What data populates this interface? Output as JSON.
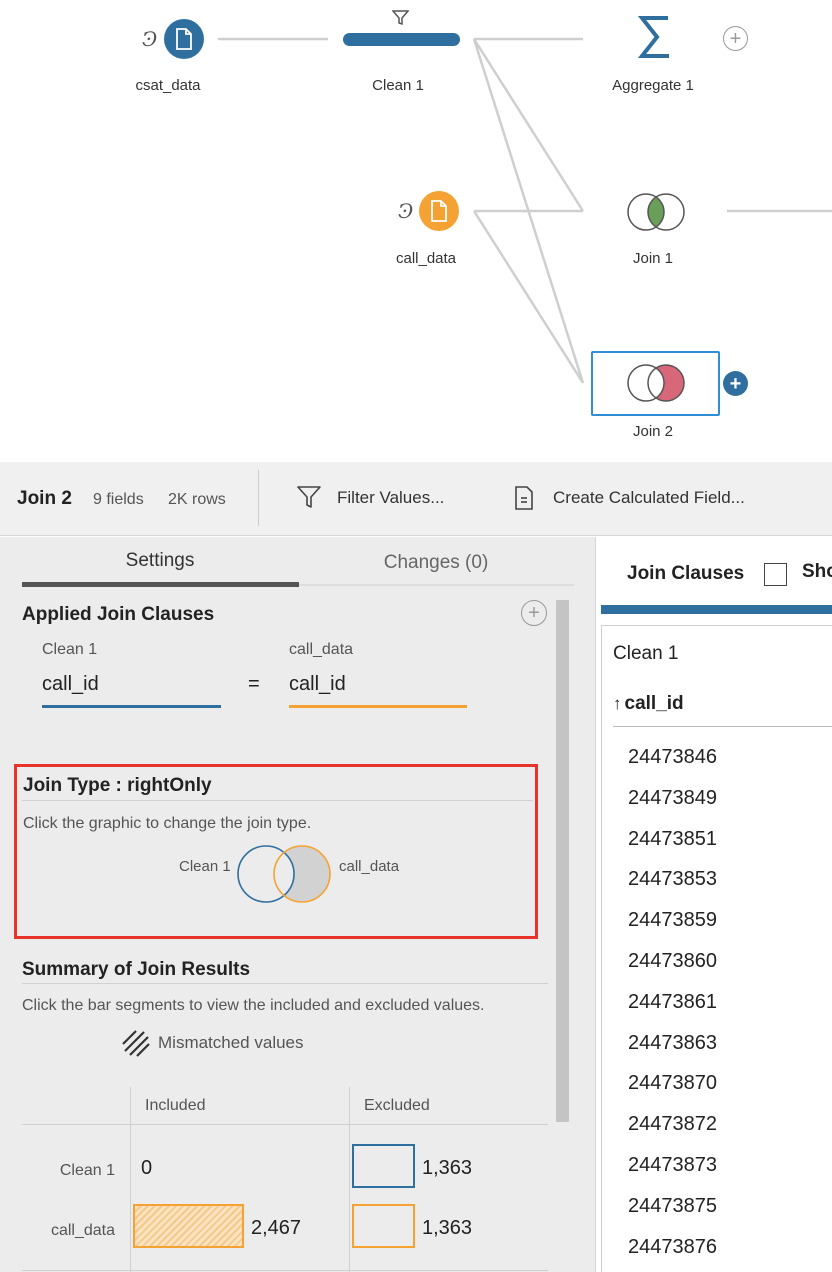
{
  "flow": {
    "nodes": {
      "csat": "csat_data",
      "clean": "Clean 1",
      "aggregate": "Aggregate 1",
      "call": "call_data",
      "join1": "Join 1",
      "join2": "Join 2"
    }
  },
  "toolbar": {
    "step_name": "Join 2",
    "fields": "9 fields",
    "rows": "2K rows",
    "filter_label": "Filter Values...",
    "calc_label": "Create Calculated Field..."
  },
  "settings": {
    "tabs": [
      "Settings",
      "Changes (0)"
    ],
    "applied_title": "Applied Join Clauses",
    "left_source": "Clean 1",
    "right_source": "call_data",
    "left_field": "call_id",
    "operator": "=",
    "right_field": "call_id",
    "join_type_title": "Join Type : rightOnly",
    "join_type_hint": "Click the graphic to change the join type.",
    "venn_left_label": "Clean 1",
    "venn_right_label": "call_data",
    "summary_title": "Summary of Join Results",
    "summary_hint": "Click the bar segments to view the included and excluded values.",
    "mismatched_label": "Mismatched values",
    "results": {
      "col_included": "Included",
      "col_excluded": "Excluded",
      "rows": [
        {
          "label": "Clean 1",
          "included": "0",
          "excluded": "1,363"
        },
        {
          "label": "call_data",
          "included": "2,467",
          "excluded": "1,363"
        }
      ]
    }
  },
  "clauses_panel": {
    "title": "Join Clauses",
    "show_checkbox_label": "Sho",
    "source": "Clean 1",
    "column": "call_id",
    "sort_glyph": "↑",
    "values": [
      "24473846",
      "24473849",
      "24473851",
      "24473853",
      "24473859",
      "24473860",
      "24473861",
      "24473863",
      "24473870",
      "24473872",
      "24473873",
      "24473875",
      "24473876"
    ]
  },
  "colors": {
    "blue": "#2f6fa0",
    "orange": "#f4a233",
    "selection": "#2f8ed4",
    "join_green": "#6a9f5a",
    "join_red": "#d9677a",
    "highlight_red": "#e8332a"
  }
}
